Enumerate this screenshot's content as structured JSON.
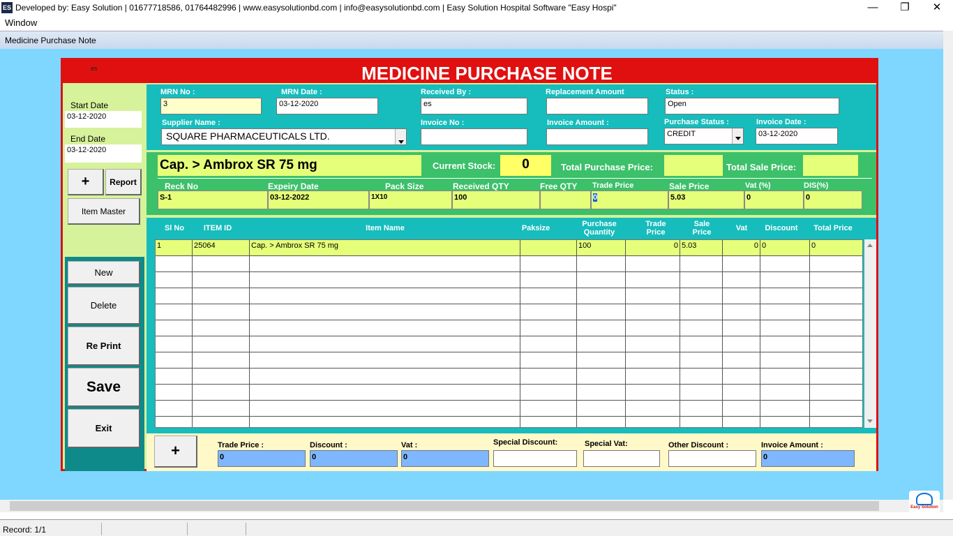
{
  "window": {
    "title": "Developed by: Easy Solution | 01677718586,  01764482996 |  www.easysolutionbd.com |  info@easysolutionbd.com |  Easy Solution Hospital Software \"Easy Hospi\"",
    "icon": "ES",
    "minimize": "—",
    "restore": "❐",
    "close": "✕"
  },
  "menu": {
    "window": "Window"
  },
  "child": {
    "title": "Medicine Purchase Note"
  },
  "form": {
    "title": "MEDICINE PURCHASE NOTE",
    "user": "es"
  },
  "left": {
    "start_label": "Start Date",
    "start_value": "03-12-2020",
    "end_label": "End Date",
    "end_value": "03-12-2020",
    "plus": "+",
    "report": "Report",
    "item_master": "Item Master",
    "new": "New",
    "delete": "Delete",
    "reprint": "Re Print",
    "save": "Save",
    "exit": "Exit"
  },
  "top": {
    "mrn_no_label": "MRN No :",
    "mrn_no": "3",
    "mrn_date_label": "MRN Date :",
    "mrn_date": "03-12-2020",
    "received_by_label": "Received By :",
    "received_by": "es",
    "replacement_label": "Replacement Amount",
    "replacement": "",
    "status_label": "Status :",
    "status": "Open",
    "supplier_label": "Supplier Name :",
    "supplier": "SQUARE PHARMACEUTICALS LTD.",
    "invoice_no_label": "Invoice No :",
    "invoice_no": "",
    "invoice_amount_label": "Invoice Amount :",
    "invoice_amount": "",
    "purchase_status_label": "Purchase Status :",
    "purchase_status": "CREDIT",
    "invoice_date_label": "Invoice Date :",
    "invoice_date": "03-12-2020"
  },
  "item": {
    "name": "Cap. > Ambrox SR 75 mg",
    "current_stock_label": "Current Stock:",
    "current_stock": "0",
    "total_purchase_label": "Total Purchase Price:",
    "total_purchase": "",
    "total_sale_label": "Total Sale Price:",
    "total_sale": "",
    "headers": [
      "Reck No",
      "Expeiry Date",
      "Pack Size",
      "Received  QTY",
      "Free QTY",
      "Trade Price",
      "Sale Price",
      "Vat (%)",
      "DIS(%)"
    ],
    "values": [
      "S-1",
      "03-12-2022",
      "1X10",
      "100",
      "",
      "0",
      "5.03",
      "0",
      "0"
    ]
  },
  "grid": {
    "headers": [
      "Sl No",
      "ITEM ID",
      "Item Name",
      "Paksize",
      "Purchase\nQuantity",
      "Trade\nPrice",
      "Sale\nPrice",
      "Vat",
      "Discount",
      "Total Price"
    ],
    "rows": [
      [
        "1",
        "25064",
        "Cap. > Ambrox SR 75 mg",
        "",
        "100",
        "0",
        "5.03",
        "0",
        "0",
        "0"
      ]
    ],
    "empty_rows": 11
  },
  "bottom": {
    "plus": "+",
    "trade_price_label": "Trade Price :",
    "trade_price": "0",
    "discount_label": "Discount :",
    "discount": "0",
    "vat_label": "Vat :",
    "vat": "0",
    "special_discount_label": "Special Discount:",
    "special_discount": "",
    "special_vat_label": "Special Vat:",
    "special_vat": "",
    "other_discount_label": "Other Discount :",
    "other_discount": "",
    "invoice_amount_label": "Invoice Amount :",
    "invoice_amount": "0"
  },
  "status": {
    "record": "Record: 1/1"
  },
  "logo": {
    "text": "Easy Solution"
  }
}
